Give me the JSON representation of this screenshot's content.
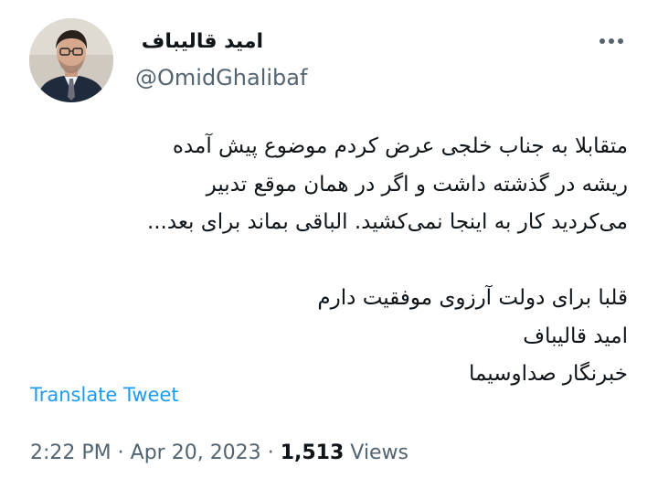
{
  "author": {
    "display_name": "امید قالیباف",
    "handle": "@OmidGhalibaf",
    "avatar_icon": "profile-photo"
  },
  "more_icon": "more-horizontal-icon",
  "tweet": {
    "lines": [
      "متقابلا به جناب خلجی عرض کردم موضوع پیش آمده",
      "ریشه در گذشته داشت و اگر در همان موقع تدبیر",
      "می‌کردید کار به اینجا نمی‌کشید. الباقی بماند برای بعد...",
      "",
      "قلبا برای دولت آرزوی موفقیت دارم",
      "امید قالیباف",
      "خبرنگار صداوسیما"
    ]
  },
  "translate_label": "Translate Tweet",
  "meta": {
    "time": "2:22 PM",
    "separator": "·",
    "date": "Apr 20, 2023",
    "views_count": "1,513",
    "views_label": "Views"
  },
  "colors": {
    "text": "#0f1419",
    "secondary": "#536471",
    "link": "#1d9bf0",
    "background": "#ffffff"
  }
}
